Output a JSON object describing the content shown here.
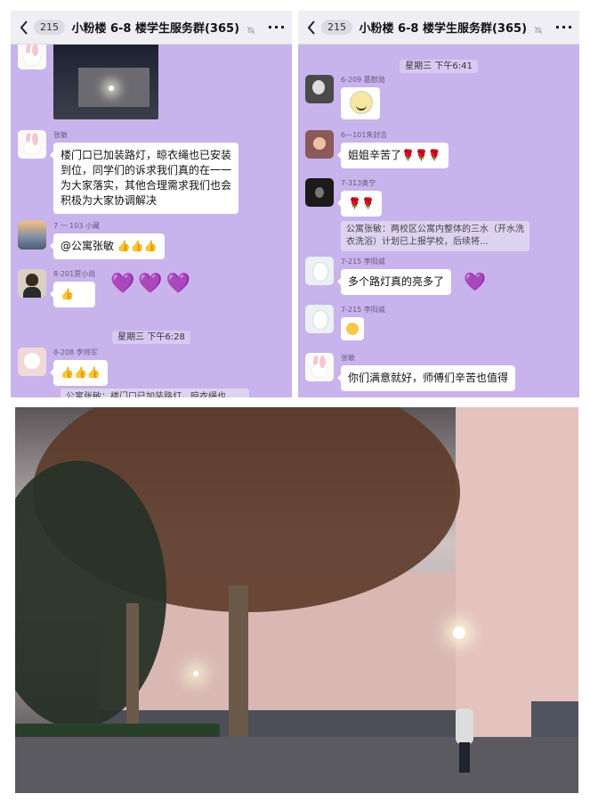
{
  "left_chat": {
    "header": {
      "unread_count": "215",
      "title": "小粉楼 6-8 楼学生服务群(365)",
      "more": "···"
    },
    "messages": [
      {
        "sender": "张敏",
        "text": "楼门口已加装路灯，晾衣绳也已安装到位，同学们的诉求我们真的在一一为大家落实，其他合理需求我们也会积极为大家协调解决"
      },
      {
        "sender": "7 一 103 小藏",
        "text": "@公寓张敏 👍👍👍"
      },
      {
        "sender": "8-201贾小尚",
        "text": "👍"
      },
      {
        "sender": "8-208 李帅军",
        "text": "👍👍👍"
      }
    ],
    "hearts": [
      "💜",
      "💜",
      "💜"
    ],
    "time_divider": "星期三 下午6:28",
    "quote_fragment": "公寓张敏：楼门口已加装路灯，晾衣绳也"
  },
  "right_chat": {
    "header": {
      "unread_count": "215",
      "title": "小粉楼 6-8 楼学生服务群(365)",
      "more": "···"
    },
    "time_divider": "星期三 下午6:41",
    "messages": [
      {
        "sender": "6-209 葛猷勋",
        "text": ""
      },
      {
        "sender": "6—101朱封吉",
        "text": "姐姐辛苦了🌹🌹🌹"
      },
      {
        "sender": "7-313奥宁",
        "text": "🌹🌹"
      },
      {
        "sender": "7-215 李阳威",
        "text": "多个路灯真的亮多了"
      },
      {
        "sender": "7-215 李阳威",
        "text": ""
      },
      {
        "sender": "张敏",
        "text": "你们满意就好，师傅们辛苦也值得"
      }
    ],
    "quote": "公寓张敏：两校区公寓内整体的三水（开水洗衣洗浴）计划已上报学校，后续将..."
  },
  "colors": {
    "chat_bg": "#c8b3ec",
    "header_bg": "#efeef4",
    "bubble_bg": "#ffffff",
    "heart": "#9b4ce0"
  }
}
